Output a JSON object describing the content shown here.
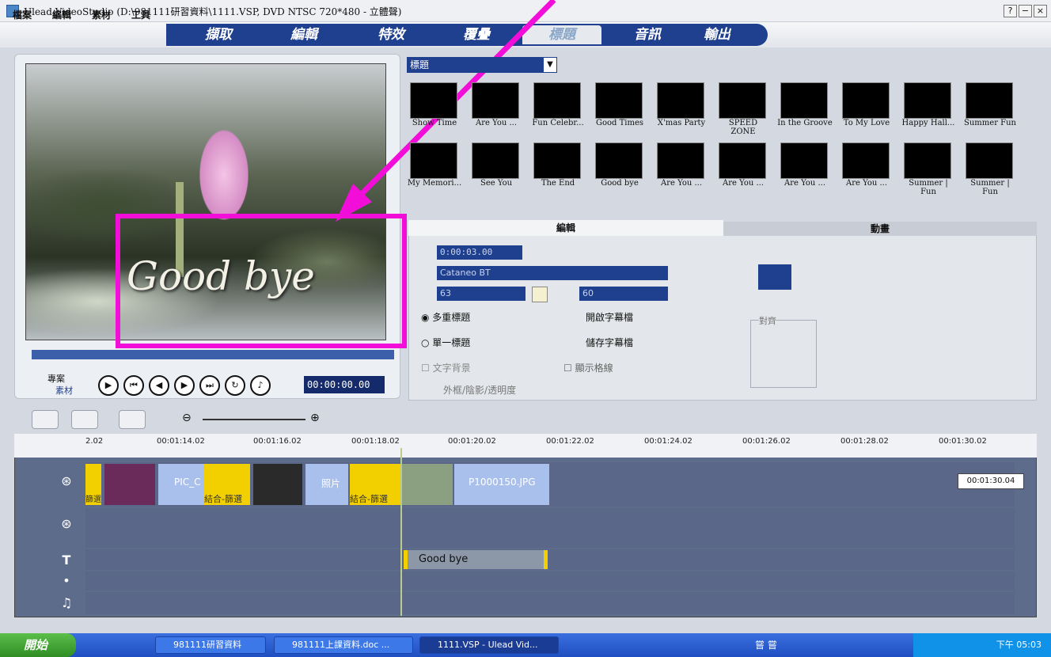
{
  "window": {
    "title": "Ulead VideoStudio (D:\\981111研習資料\\1111.VSP, DVD NTSC 720*480 - 立體聲)",
    "controls": [
      "?",
      "−",
      "×"
    ]
  },
  "menu": [
    "檔案",
    "編輯",
    "素材",
    "工具"
  ],
  "steps": [
    "擷取",
    "編輯",
    "特效",
    "覆疊",
    "標題",
    "音訊",
    "輸出"
  ],
  "preview": {
    "overlay_text": "Good bye",
    "timecode": "00:00:00.00",
    "mode_project": "專案",
    "mode_clip": "素材"
  },
  "library": {
    "category": "標題",
    "row1": [
      "Show Time",
      "Are You ...",
      "Fun Celebr...",
      "Good Times",
      "X'mas Party",
      "SPEED ZONE",
      "In the Groove",
      "To My Love",
      "Happy Hall...",
      "Summer Fun"
    ],
    "row2": [
      "My Memori...",
      "See You",
      "The End",
      "Good bye",
      "Are You ...",
      "Are You ...",
      "Are You ...",
      "Are You ...",
      "Summer | Fun",
      "Summer | Fun"
    ]
  },
  "edit": {
    "tab_edit": "編輯",
    "tab_anim": "動畫",
    "duration": "0:00:03.00",
    "font": "Cataneo BT",
    "size": "63",
    "line_spacing": "60",
    "multi_title": "多重標題",
    "single_title": "單一標題",
    "text_bg": "文字背景",
    "open_subtitle": "開啟字幕檔",
    "save_subtitle": "儲存字幕檔",
    "show_grid": "顯示格線",
    "border_shadow": "外框/陰影/透明度",
    "align_label": "對齊"
  },
  "timeline": {
    "ticks": [
      "2.02",
      "00:01:14.02",
      "00:01:16.02",
      "00:01:18.02",
      "00:01:20.02",
      "00:01:22.02",
      "00:01:24.02",
      "00:01:26.02",
      "00:01:28.02",
      "00:01:30.02"
    ],
    "clips": [
      "PIC_C",
      "照片",
      "P1000150.JPG"
    ],
    "transitions": [
      "篩選",
      "結合-篩選",
      "結合-篩選"
    ],
    "title_clip": "Good bye",
    "total": "00:01:30.04"
  },
  "taskbar": {
    "start": "開始",
    "tasks": [
      "981111研習資料",
      "981111上課資料.doc ...",
      "1111.VSP - Ulead Vid..."
    ],
    "clock": "下午 05:03",
    "ime": "嘗 嘗"
  },
  "colors": {
    "accent": "#1f3f8f",
    "highlight": "#f20ed8"
  }
}
